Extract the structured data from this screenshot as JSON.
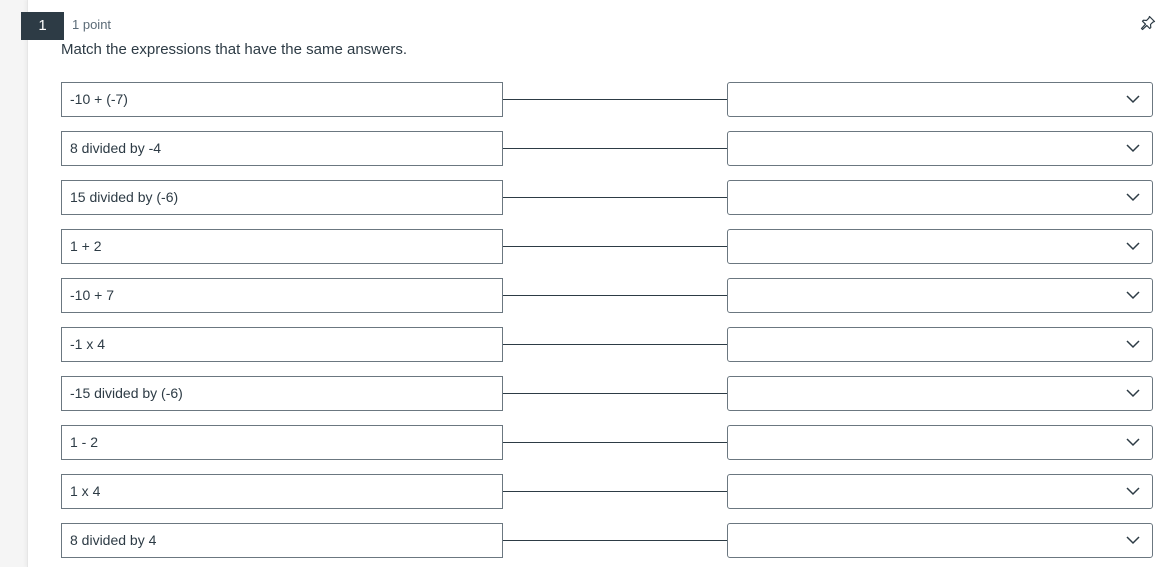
{
  "question": {
    "number": "1",
    "points": "1 point",
    "prompt": "Match the expressions that have the same answers."
  },
  "icons": {
    "pin": "pin-icon",
    "dropdown": "chevron-down-icon"
  },
  "colors": {
    "number_badge_bg": "#2d3b45",
    "text": "#2d3b45",
    "border": "#6b7780"
  },
  "matches": [
    {
      "prompt": "-10 + (-7)",
      "selected": ""
    },
    {
      "prompt": "8 divided by -4",
      "selected": ""
    },
    {
      "prompt": "15 divided by (-6)",
      "selected": ""
    },
    {
      "prompt": "1 + 2",
      "selected": ""
    },
    {
      "prompt": "-10 + 7",
      "selected": ""
    },
    {
      "prompt": "-1 x 4",
      "selected": ""
    },
    {
      "prompt": "-15 divided by (-6)",
      "selected": ""
    },
    {
      "prompt": "1 - 2",
      "selected": ""
    },
    {
      "prompt": "1 x 4",
      "selected": ""
    },
    {
      "prompt": "8 divided by 4",
      "selected": ""
    }
  ]
}
